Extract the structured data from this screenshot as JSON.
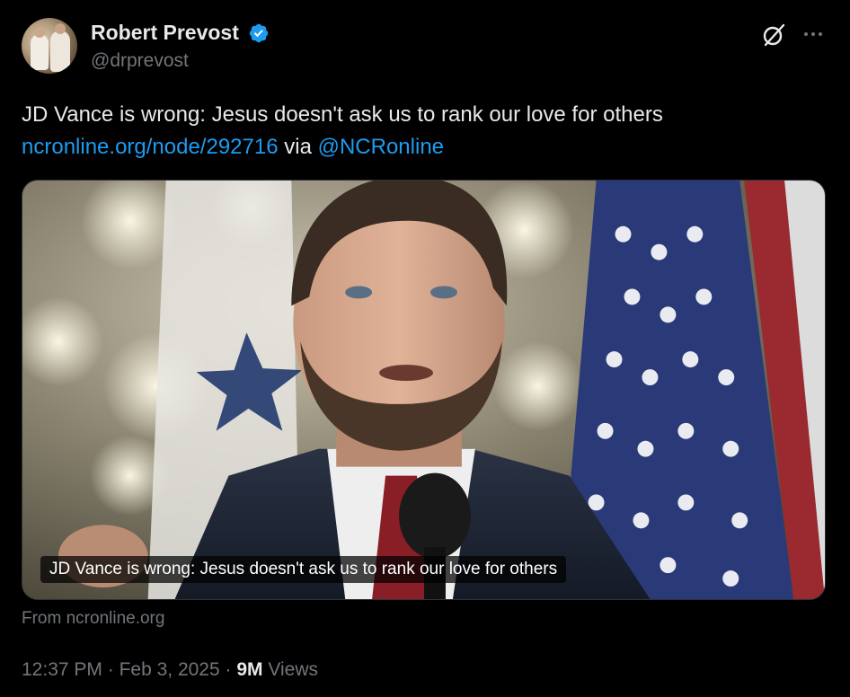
{
  "author": {
    "display_name": "Robert Prevost",
    "handle": "@drprevost",
    "verified": true
  },
  "icons": {
    "avatar": "avatar-photo",
    "verified": "verified-badge-icon",
    "grok": "grok-icon",
    "more": "more-options-icon"
  },
  "tweet": {
    "text": "JD Vance is wrong: Jesus doesn't ask us to rank our love for others",
    "link": "ncronline.org/node/292716",
    "via": "via",
    "mention": "@NCRonline"
  },
  "card": {
    "caption": "JD Vance is wrong: Jesus doesn't ask us to rank our love for others",
    "source": "From ncronline.org"
  },
  "meta": {
    "time": "12:37 PM",
    "separator": "·",
    "date": "Feb 3, 2025",
    "views_count": "9M",
    "views_label": "Views"
  },
  "colors": {
    "background": "#000000",
    "text": "#e7e9ea",
    "secondary": "#71767b",
    "link": "#1d9bf0",
    "verified": "#1d9bf0"
  }
}
